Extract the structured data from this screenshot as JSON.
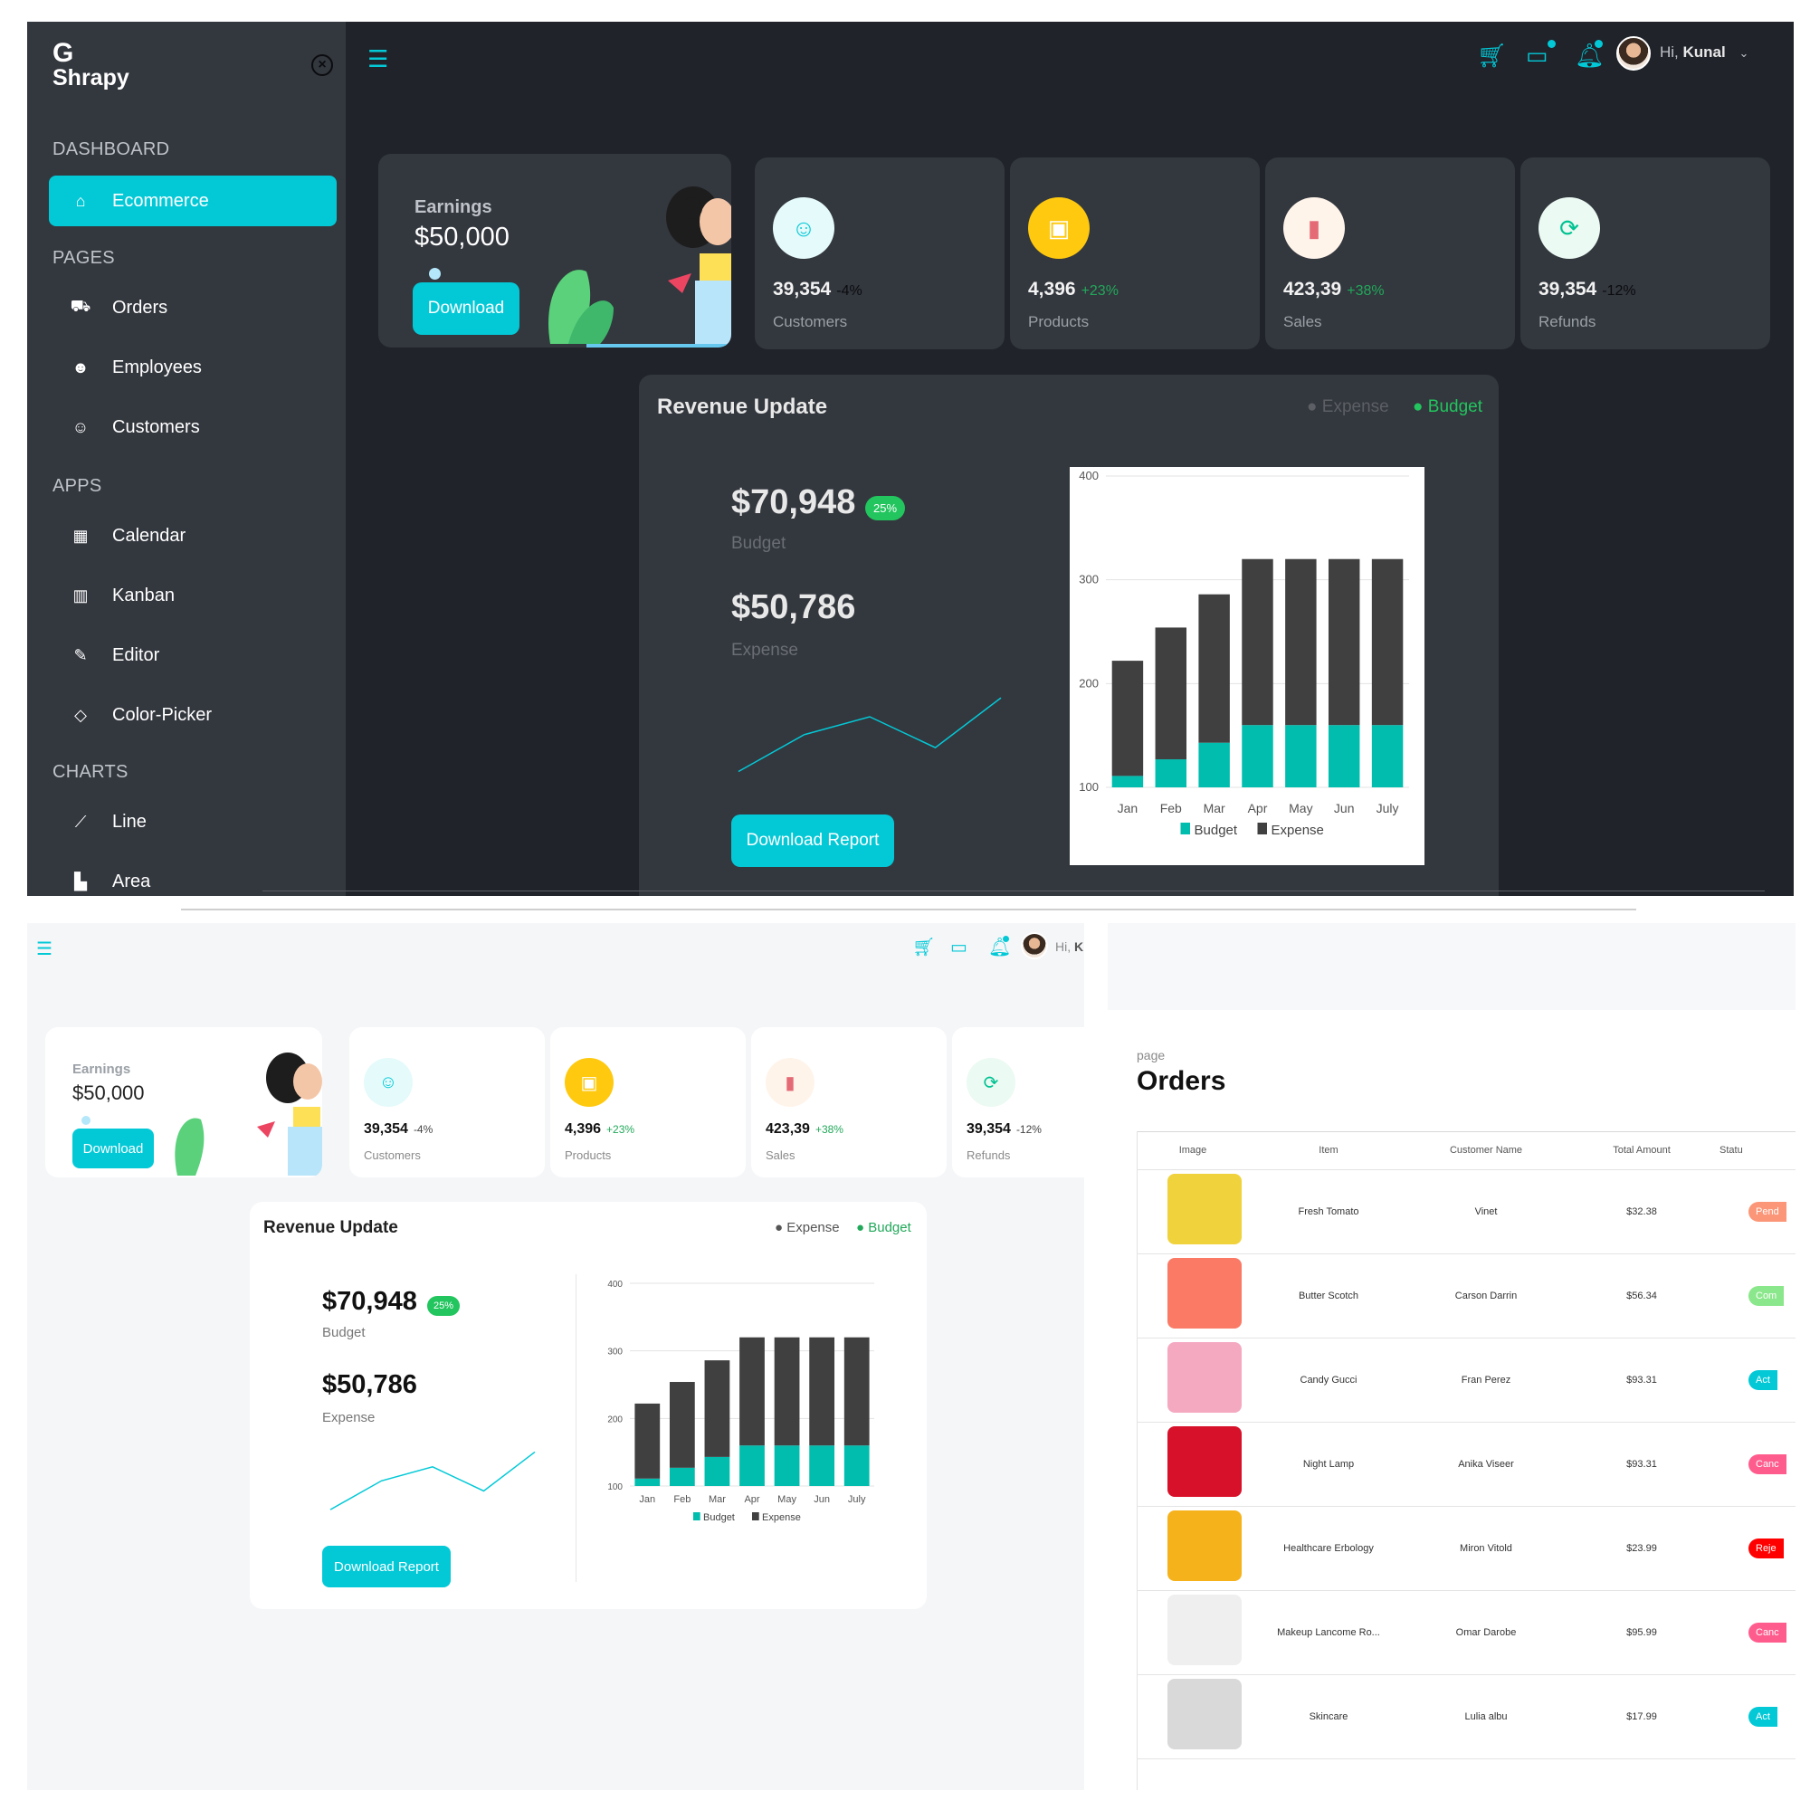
{
  "brand": {
    "logo_mark": "G",
    "name": "Shrapy"
  },
  "sidebar": {
    "sections": [
      "DASHBOARD",
      "PAGES",
      "APPS",
      "CHARTS"
    ],
    "items": [
      {
        "label": "Ecommerce",
        "icon": "shopping-bag-icon"
      },
      {
        "label": "Orders",
        "icon": "cart-icon"
      },
      {
        "label": "Employees",
        "icon": "people-icon"
      },
      {
        "label": "Customers",
        "icon": "customers-icon"
      },
      {
        "label": "Calendar",
        "icon": "calendar-icon"
      },
      {
        "label": "Kanban",
        "icon": "kanban-icon"
      },
      {
        "label": "Editor",
        "icon": "edit-icon"
      },
      {
        "label": "Color-Picker",
        "icon": "paint-bucket-icon"
      },
      {
        "label": "Line",
        "icon": "line-chart-icon"
      },
      {
        "label": "Area",
        "icon": "area-chart-icon"
      }
    ]
  },
  "header": {
    "greeting": "Hi,",
    "user": "Kunal",
    "user_short": "K"
  },
  "earnings": {
    "label": "Earnings",
    "value": "$50,000",
    "button": "Download"
  },
  "stats": [
    {
      "value": "39,354",
      "pct": "-4%",
      "label": "Customers",
      "icon": "customers-icon",
      "icon_color": "#03c9d7",
      "bg": "#e5fafb",
      "pct_color": "#444444"
    },
    {
      "value": "4,396",
      "pct": "+23%",
      "label": "Products",
      "icon": "box-icon",
      "icon_color": "#ffffff",
      "bg": "#fec90f",
      "pct_color": "#22a85a"
    },
    {
      "value": "423,39",
      "pct": "+38%",
      "label": "Sales",
      "icon": "bar-chart-icon",
      "icon_color": "#e46a76",
      "bg": "#fff4ea",
      "pct_color": "#22a85a"
    },
    {
      "value": "39,354",
      "pct": "-12%",
      "label": "Refunds",
      "icon": "refresh-icon",
      "icon_color": "#00c292",
      "bg": "#ebfaf2",
      "pct_color": "#444444"
    }
  ],
  "revenue": {
    "title": "Revenue Update",
    "legend_expense": "Expense",
    "legend_budget": "Budget",
    "budget_value": "$70,948",
    "badge": "25%",
    "budget_label": "Budget",
    "expense_value": "$50,786",
    "expense_label": "Expense",
    "button": "Download Report",
    "colors": {
      "budget": "#00bdae",
      "expense": "#404041",
      "accent": "#03c9d7"
    }
  },
  "sparkline": [
    15,
    52,
    70,
    39,
    89
  ],
  "chart_data": {
    "type": "bar",
    "stacked": true,
    "categories": [
      "Jan",
      "Feb",
      "Mar",
      "Apr",
      "May",
      "Jun",
      "July"
    ],
    "series": [
      {
        "name": "Budget",
        "values": [
          111,
          127,
          143,
          160,
          160,
          160,
          160
        ]
      },
      {
        "name": "Expense",
        "values": [
          111,
          127,
          143,
          160,
          160,
          160,
          160
        ]
      }
    ],
    "ylim": [
      100,
      400
    ],
    "yticks": [
      100,
      200,
      300,
      400
    ],
    "grid": true,
    "legend_position": "bottom"
  },
  "orders_page": {
    "breadcrumb": "page",
    "title": "Orders",
    "columns": [
      "Image",
      "Item",
      "Customer Name",
      "Total Amount",
      "Statu"
    ],
    "rows": [
      {
        "item": "Fresh Tomato",
        "customer": "Vinet",
        "amount": "$32.38",
        "status": "Pend",
        "status_color": "#fb9678",
        "img_bg": "#f0d23c",
        "thumb": "tomato-image"
      },
      {
        "item": "Butter Scotch",
        "customer": "Carson Darrin",
        "amount": "$56.34",
        "status": "Com",
        "status_color": "#8be78b",
        "img_bg": "#fa7a66",
        "thumb": "dessert-cup-image"
      },
      {
        "item": "Candy Gucci",
        "customer": "Fran Perez",
        "amount": "$93.31",
        "status": "Act",
        "status_color": "#03c9d7",
        "img_bg": "#f4a9c1",
        "thumb": "ice-cream-image"
      },
      {
        "item": "Night Lamp",
        "customer": "Anika Viseer",
        "amount": "$93.31",
        "status": "Canc",
        "status_color": "#ff5c8e",
        "img_bg": "#d8112a",
        "thumb": "red-shoe-image"
      },
      {
        "item": "Healthcare Erbology",
        "customer": "Miron Vitold",
        "amount": "$23.99",
        "status": "Reje",
        "status_color": "#ff0000",
        "img_bg": "#f6b21b",
        "thumb": "toy-car-image"
      },
      {
        "item": "Makeup Lancome Ro...",
        "customer": "Omar Darobe",
        "amount": "$95.99",
        "status": "Canc",
        "status_color": "#ff5c8e",
        "img_bg": "#efefef",
        "thumb": "sunglasses-image"
      },
      {
        "item": "Skincare",
        "customer": "Lulia albu",
        "amount": "$17.99",
        "status": "Act",
        "status_color": "#03c9d7",
        "img_bg": "#d9d9d9",
        "thumb": "watch-image"
      }
    ]
  }
}
